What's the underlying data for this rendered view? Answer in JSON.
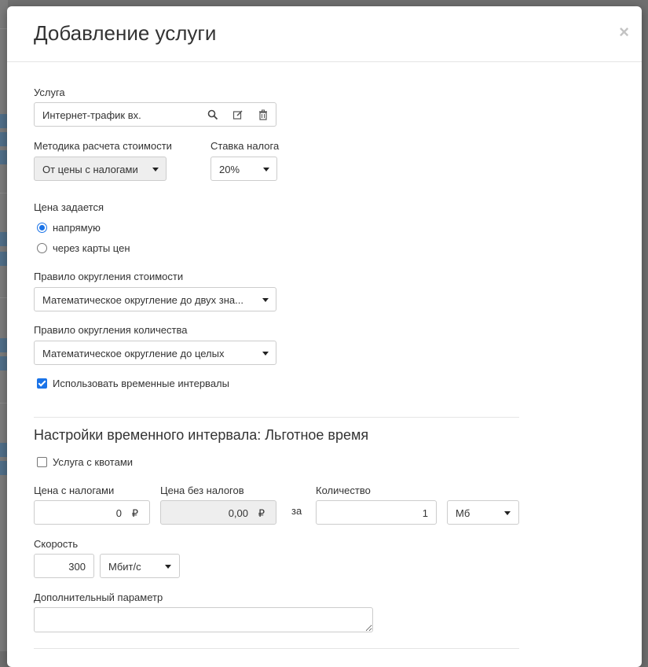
{
  "dialog": {
    "title": "Добавление услуги",
    "close_symbol": "×"
  },
  "service": {
    "label": "Услуга",
    "value": "Интернет-трафик вх.",
    "icons": [
      "search-icon",
      "edit-icon",
      "trash-icon"
    ]
  },
  "cost_method": {
    "label": "Методика расчета стоимости",
    "value": "От цены с налогами"
  },
  "tax_rate": {
    "label": "Ставка налога",
    "value": "20%"
  },
  "price_set": {
    "label": "Цена задается",
    "options": [
      {
        "label": "напрямую",
        "checked": true
      },
      {
        "label": "через карты цен",
        "checked": false
      }
    ]
  },
  "cost_rounding": {
    "label": "Правило округления стоимости",
    "value": "Математическое округление до двух зна..."
  },
  "qty_rounding": {
    "label": "Правило округления количества",
    "value": "Математическое округление до целых"
  },
  "use_intervals": {
    "label": "Использовать временные интервалы",
    "checked": true
  },
  "interval": {
    "title": "Настройки временного интервала: Льготное время",
    "quota": {
      "label": "Услуга с квотами",
      "checked": false
    },
    "price_with_tax": {
      "label": "Цена с налогами",
      "value": "0",
      "currency": "₽"
    },
    "price_without_tax": {
      "label": "Цена без налогов",
      "value": "0,00",
      "currency": "₽"
    },
    "per_label": "за",
    "quantity": {
      "label": "Количество",
      "value": "1"
    },
    "unit": {
      "value": "Мб"
    },
    "speed": {
      "label": "Скорость",
      "value": "300",
      "unit": "Мбит/с"
    },
    "extra_param": {
      "label": "Дополнительный параметр",
      "value": ""
    }
  },
  "colors": {
    "accent": "#1a73e8",
    "backdrop": "#6f6f6f",
    "readonly_bg": "#eeeeee"
  }
}
